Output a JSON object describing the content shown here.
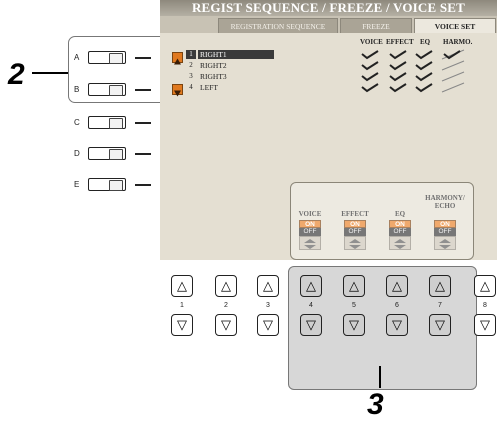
{
  "callouts": {
    "step2": "2",
    "step3": "3"
  },
  "side_buttons": [
    {
      "letter": "A"
    },
    {
      "letter": "B"
    },
    {
      "letter": "C"
    },
    {
      "letter": "D"
    },
    {
      "letter": "E"
    }
  ],
  "screen": {
    "title": "REGIST SEQUENCE / FREEZE / VOICE SET",
    "tabs": [
      "REGISTRATION SEQUENCE",
      "FREEZE",
      "VOICE SET"
    ],
    "active_tab": "VOICE SET",
    "columns": [
      "VOICE",
      "EFFECT",
      "EQ",
      "HARMO."
    ],
    "parts": [
      {
        "num": "1",
        "name": "RIGHT1",
        "selected": true
      },
      {
        "num": "2",
        "name": "RIGHT2",
        "selected": false
      },
      {
        "num": "3",
        "name": "RIGHT3",
        "selected": false
      },
      {
        "num": "4",
        "name": "LEFT",
        "selected": false
      }
    ],
    "knobs": [
      {
        "label": "VOICE",
        "on": "ON",
        "off": "OFF"
      },
      {
        "label": "EFFECT",
        "on": "ON",
        "off": "OFF"
      },
      {
        "label": "EQ",
        "on": "ON",
        "off": "OFF"
      },
      {
        "label": "HARMONY/ ECHO",
        "on": "ON",
        "off": "OFF"
      }
    ]
  },
  "bottom_buttons": {
    "up_symbol": "△",
    "down_symbol": "▽",
    "numbers": [
      "1",
      "2",
      "3",
      "4",
      "5",
      "6",
      "7",
      "8"
    ]
  },
  "colors": {
    "accent_orange": "#e87b1e",
    "screen_bg": "#e4dfd2",
    "title_bar": "#9d988b"
  }
}
